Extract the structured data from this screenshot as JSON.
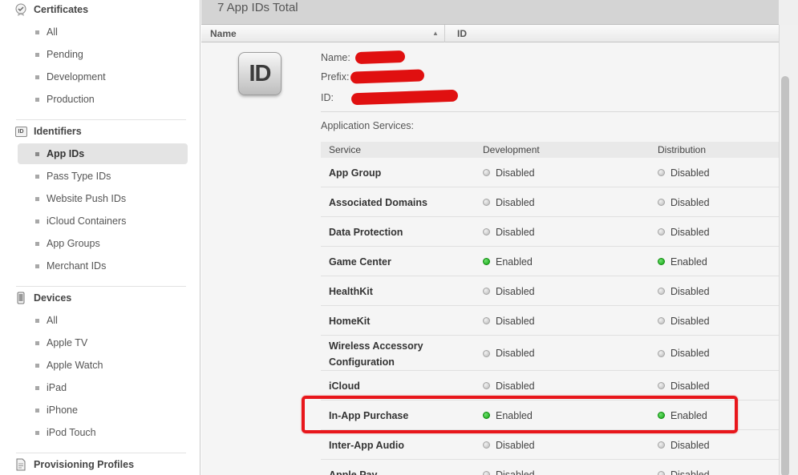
{
  "sidebar": {
    "sections": [
      {
        "title": "Certificates",
        "icon": "certificate-icon",
        "items": [
          "All",
          "Pending",
          "Development",
          "Production"
        ]
      },
      {
        "title": "Identifiers",
        "icon": "id-icon",
        "icon_text": "ID",
        "items": [
          "App IDs",
          "Pass Type IDs",
          "Website Push IDs",
          "iCloud Containers",
          "App Groups",
          "Merchant IDs"
        ],
        "selected": "App IDs"
      },
      {
        "title": "Devices",
        "icon": "device-icon",
        "items": [
          "All",
          "Apple TV",
          "Apple Watch",
          "iPad",
          "iPhone",
          "iPod Touch"
        ]
      },
      {
        "title": "Provisioning Profiles",
        "icon": "document-icon",
        "items": []
      }
    ]
  },
  "main": {
    "total": "7 App IDs Total",
    "columns": {
      "name": "Name",
      "id": "ID"
    },
    "app_icon_text": "ID",
    "meta": {
      "name_label": "Name:",
      "prefix_label": "Prefix:",
      "id_label": "ID:"
    },
    "app_services_label": "Application Services:",
    "services_header": {
      "service": "Service",
      "development": "Development",
      "distribution": "Distribution"
    },
    "services": [
      {
        "name": "App Group",
        "development": "Disabled",
        "distribution": "Disabled"
      },
      {
        "name": "Associated Domains",
        "development": "Disabled",
        "distribution": "Disabled"
      },
      {
        "name": "Data Protection",
        "development": "Disabled",
        "distribution": "Disabled"
      },
      {
        "name": "Game Center",
        "development": "Enabled",
        "distribution": "Enabled"
      },
      {
        "name": "HealthKit",
        "development": "Disabled",
        "distribution": "Disabled"
      },
      {
        "name": "HomeKit",
        "development": "Disabled",
        "distribution": "Disabled"
      },
      {
        "name": "Wireless Accessory Configuration",
        "development": "Disabled",
        "distribution": "Disabled"
      },
      {
        "name": "iCloud",
        "development": "Disabled",
        "distribution": "Disabled"
      },
      {
        "name": "In-App Purchase",
        "development": "Enabled",
        "distribution": "Enabled"
      },
      {
        "name": "Inter-App Audio",
        "development": "Disabled",
        "distribution": "Disabled"
      },
      {
        "name": "Apple Pay",
        "development": "Disabled",
        "distribution": "Disabled"
      }
    ],
    "highlighted_service": "In-App Purchase"
  },
  "colors": {
    "enabled": "#1db41d",
    "disabled": "#b9b9b9",
    "highlight": "#e8161b",
    "redaction": "#e01010"
  }
}
